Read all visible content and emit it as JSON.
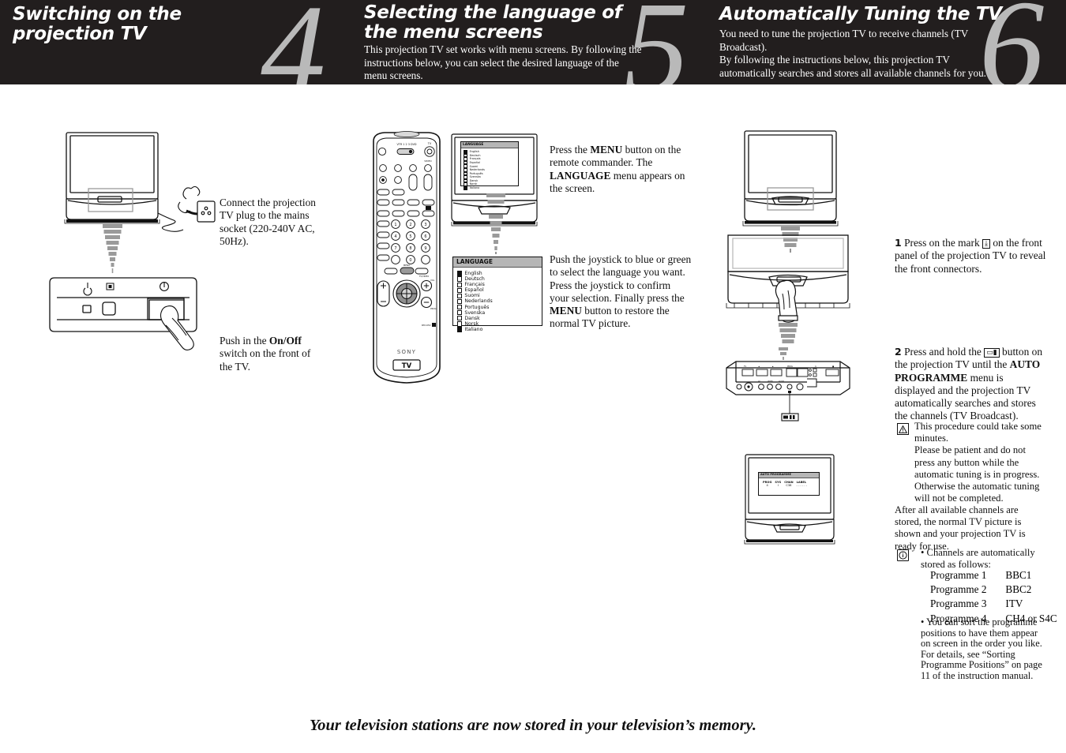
{
  "sections": [
    {
      "id": "step4",
      "number": "4",
      "title_lines": [
        "Switching on the",
        "projection TV"
      ],
      "subtitle": ""
    },
    {
      "id": "step5",
      "number": "5",
      "title_lines": [
        "Selecting the language of",
        "the menu screens"
      ],
      "subtitle": "This projection TV set works with menu screens. By following the instructions below, you can select the desired language of the menu screens."
    },
    {
      "id": "step6",
      "number": "6",
      "title_lines": [
        "Automatically Tuning the TV"
      ],
      "subtitle": "You need to tune the projection TV to receive channels (TV Broadcast).\nBy following the instructions below, this projection TV automatically searches and stores all available channels for you."
    }
  ],
  "col1": {
    "caption_plug": "Connect the projection TV plug to the mains socket (220-240V AC, 50Hz).",
    "caption_switch_pre": "Push in the ",
    "caption_switch_bold": "On/Off",
    "caption_switch_post": " switch on the front of the TV.",
    "panel_icons": [
      "standby-power-icon",
      "video-input-icon",
      "on-off-power-icon"
    ]
  },
  "col2": {
    "caption_menu_a": "Press the ",
    "caption_menu_b": "MENU",
    "caption_menu_c": " button on the remote commander.",
    "caption_menu_d": "The ",
    "caption_menu_e": "LANGUAGE",
    "caption_menu_f": " menu appears on the screen.",
    "caption_joy_1": "Push the joystick to blue or green to select the language you want.",
    "caption_joy_2a": "Press the joystick to confirm your selection. Finally press the ",
    "caption_joy_2b": "MENU",
    "caption_joy_2c": " button to restore the normal TV picture.",
    "language_menu": {
      "title": "LANGUAGE",
      "items": [
        {
          "label": "English",
          "selected": true
        },
        {
          "label": "Deutsch",
          "selected": false
        },
        {
          "label": "Français",
          "selected": false
        },
        {
          "label": "Español",
          "selected": false
        },
        {
          "label": "Suomi",
          "selected": false
        },
        {
          "label": "Nederlands",
          "selected": false
        },
        {
          "label": "Português",
          "selected": false
        },
        {
          "label": "Svenska",
          "selected": false
        },
        {
          "label": "Dansk",
          "selected": false
        },
        {
          "label": "Norsk",
          "selected": false
        },
        {
          "label": "Italiano",
          "selected": true
        }
      ]
    },
    "remote": {
      "brand": "SONY",
      "mode_button": "TV",
      "top_label": "VTR 1 2 3 DVD",
      "tv_label": "TV",
      "video_label": "VIDEO",
      "menu_label": "MENU",
      "rm_label": "RM-932"
    }
  },
  "col3": {
    "step1_num": "1",
    "step1_a": "Press on the mark ",
    "step1_icon": "front-connector-mark-icon",
    "step1_b": " on the front panel of the projection TV to reveal the front connectors.",
    "step2_num": "2",
    "step2_a": "Press and hold the ",
    "step2_icon": "auto-programme-button-icon",
    "step2_b": " button on the projection TV until the ",
    "step2_bold": "AUTO PROGRAMME",
    "step2_c": " menu is displayed and the projection TV automatically searches and stores the channels (TV Broadcast).",
    "warning_icon": "warning-triangle-icon",
    "warning_text": "This procedure could take some minutes.\nPlease be patient and do not press any button while the automatic tuning is in progress. Otherwise the automatic tuning will not be completed.",
    "after_text": "After all available channels are stored, the normal TV picture is shown and your projection TV is ready for use.",
    "info_icon": "information-circle-icon",
    "note1_title": "• Channels are automatically stored as follows:",
    "programmes": [
      {
        "name": "Programme 1",
        "channel": "BBC1"
      },
      {
        "name": "Programme 2",
        "channel": "BBC2"
      },
      {
        "name": "Programme 3",
        "channel": "ITV"
      },
      {
        "name": "Programme 4",
        "channel": "CH4 or S4C"
      }
    ],
    "note2": "• You can sort the programme positions to have them appear on screen in the order you like. For details, see “Sorting Programme Positions” on page 11 of the instruction manual.",
    "auto_programme_menu": {
      "title": "AUTO PROGRAMME",
      "headers": [
        "PROG",
        "SYS",
        "CHAN",
        "LABEL"
      ],
      "row": [
        "4",
        "I",
        "C38",
        "- - - - - -"
      ]
    }
  },
  "footer": "Your television stations are now stored in your television’s memory.",
  "colors": {
    "header_bg": "#221e1e",
    "big_number": "#b9b9b9",
    "menu_title_bg": "#b6b6b6",
    "arrow_gray": "#9a9a9a",
    "text": "#111111"
  }
}
